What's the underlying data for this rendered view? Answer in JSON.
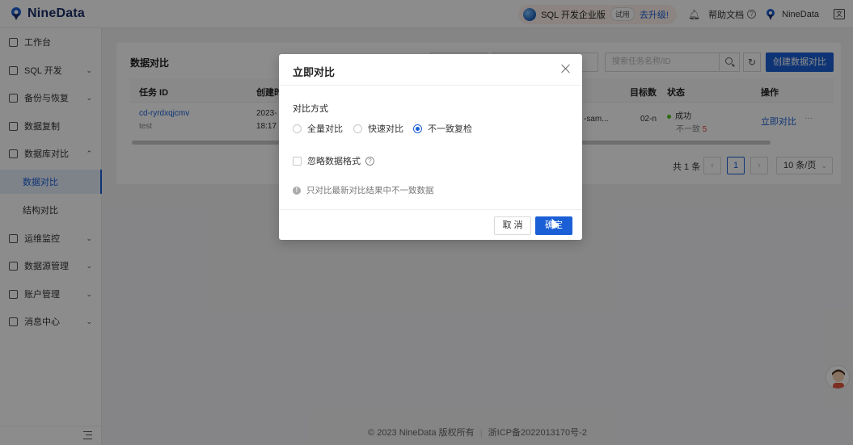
{
  "app": {
    "logo_text": "NineData"
  },
  "topbar": {
    "edition": "SQL 开发企业版",
    "trial": "试用",
    "upgrade": "去升级!",
    "help": "帮助文档",
    "user": "NineData"
  },
  "sidebar": {
    "items": [
      {
        "label": "工作台",
        "icon": "home-icon"
      },
      {
        "label": "SQL 开发",
        "icon": "sql-icon"
      },
      {
        "label": "备份与恢复",
        "icon": "backup-icon"
      },
      {
        "label": "数据复制",
        "icon": "replication-icon"
      },
      {
        "label": "数据库对比",
        "icon": "compare-icon"
      },
      {
        "label": "运维监控",
        "icon": "monitor-icon"
      },
      {
        "label": "数据源管理",
        "icon": "datasource-icon"
      },
      {
        "label": "账户管理",
        "icon": "account-icon"
      },
      {
        "label": "消息中心",
        "icon": "message-icon"
      }
    ],
    "sub_items": [
      "数据对比",
      "结构对比"
    ],
    "active_sub": "数据对比"
  },
  "main": {
    "title": "数据对比",
    "search_placeholder": "搜索任务名称/ID",
    "create_button": "创建数据对比",
    "columns": [
      "任务 ID",
      "创建时",
      "目标数",
      "状态",
      "操作"
    ],
    "row": {
      "task_id": "cd-ryrdxqjcmv",
      "task_name": "test",
      "created_date": "2023-",
      "created_time": "18:17",
      "source_frag": "-sam...",
      "target_frag": "02-n",
      "status": "成功",
      "inconsistent_label": "不一致",
      "inconsistent_count": "5",
      "action": "立即对比",
      "more": "···"
    },
    "pagination": {
      "total": "共 1 条",
      "current_page": "1",
      "page_size": "10 条/页"
    }
  },
  "footer": {
    "copyright": "© 2023 NineData 版权所有",
    "icp": "浙ICP备2022013170号-2"
  },
  "modal": {
    "title": "立即对比",
    "field_label": "对比方式",
    "options": [
      "全量对比",
      "快速对比",
      "不一致复检"
    ],
    "selected_option": "不一致复检",
    "checkbox_label": "忽略数据格式",
    "info_text": "只对比最新对比结果中不一致数据",
    "cancel": "取 消",
    "confirm": "确定"
  },
  "colors": {
    "primary": "#1b5fd6",
    "success": "#52c41a",
    "danger": "#e0453b"
  }
}
